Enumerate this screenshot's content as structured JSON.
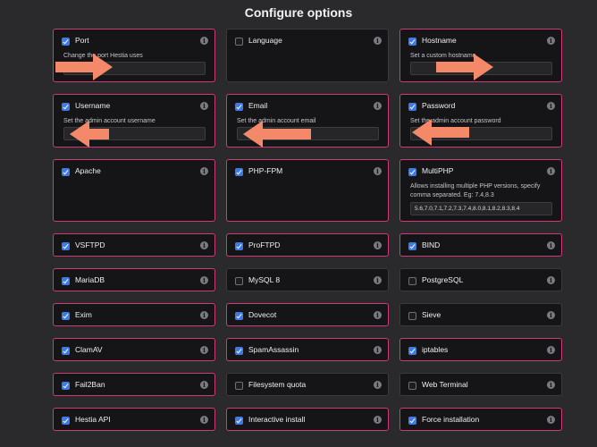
{
  "page_title": "Configure options",
  "cards": [
    {
      "id": "port",
      "label": "Port",
      "checked": true,
      "desc": "Change the port Hestia uses",
      "input": ""
    },
    {
      "id": "language",
      "label": "Language",
      "checked": false
    },
    {
      "id": "hostname",
      "label": "Hostname",
      "checked": true,
      "desc": "Set a custom hostname",
      "input": ""
    },
    {
      "id": "username",
      "label": "Username",
      "checked": true,
      "desc": "Set the admin account username",
      "input": ""
    },
    {
      "id": "email",
      "label": "Email",
      "checked": true,
      "desc": "Set the admin account email",
      "input": ""
    },
    {
      "id": "password",
      "label": "Password",
      "checked": true,
      "desc": "Set the admin account password",
      "input": ""
    },
    {
      "id": "apache",
      "label": "Apache",
      "checked": true
    },
    {
      "id": "phpfpm",
      "label": "PHP-FPM",
      "checked": true
    },
    {
      "id": "multiphp",
      "label": "MultiPHP",
      "checked": true,
      "desc": "Allows installing multiple PHP versions, specify comma separated. Eg: 7.4,8.3",
      "input": "5.6,7.0,7.1,7.2,7.3,7.4,8.0,8.1,8.2,8.3,8.4"
    },
    {
      "id": "vsftpd",
      "label": "VSFTPD",
      "checked": true
    },
    {
      "id": "proftpd",
      "label": "ProFTPD",
      "checked": true
    },
    {
      "id": "bind",
      "label": "BIND",
      "checked": true
    },
    {
      "id": "mariadb",
      "label": "MariaDB",
      "checked": true
    },
    {
      "id": "mysql8",
      "label": "MySQL 8",
      "checked": false
    },
    {
      "id": "postgresql",
      "label": "PostgreSQL",
      "checked": false
    },
    {
      "id": "exim",
      "label": "Exim",
      "checked": true
    },
    {
      "id": "dovecot",
      "label": "Dovecot",
      "checked": true
    },
    {
      "id": "sieve",
      "label": "Sieve",
      "checked": false
    },
    {
      "id": "clamav",
      "label": "ClamAV",
      "checked": true
    },
    {
      "id": "spamassassin",
      "label": "SpamAssassin",
      "checked": true
    },
    {
      "id": "iptables",
      "label": "iptables",
      "checked": true
    },
    {
      "id": "fail2ban",
      "label": "Fail2Ban",
      "checked": true
    },
    {
      "id": "fsquota",
      "label": "Filesystem quota",
      "checked": false
    },
    {
      "id": "webterminal",
      "label": "Web Terminal",
      "checked": false
    },
    {
      "id": "hestiaapi",
      "label": "Hestia API",
      "checked": true
    },
    {
      "id": "interactive",
      "label": "Interactive install",
      "checked": true
    },
    {
      "id": "force",
      "label": "Force installation",
      "checked": true
    }
  ],
  "colors": {
    "accent_border": "#d03a78",
    "checkbox": "#3f7be6",
    "arrow": "#f4896a",
    "background": "#2a2a2d",
    "card": "#151518"
  },
  "icons": {
    "info": "info-icon",
    "checkbox": "checkbox",
    "annotation": "arrow-annotation"
  }
}
